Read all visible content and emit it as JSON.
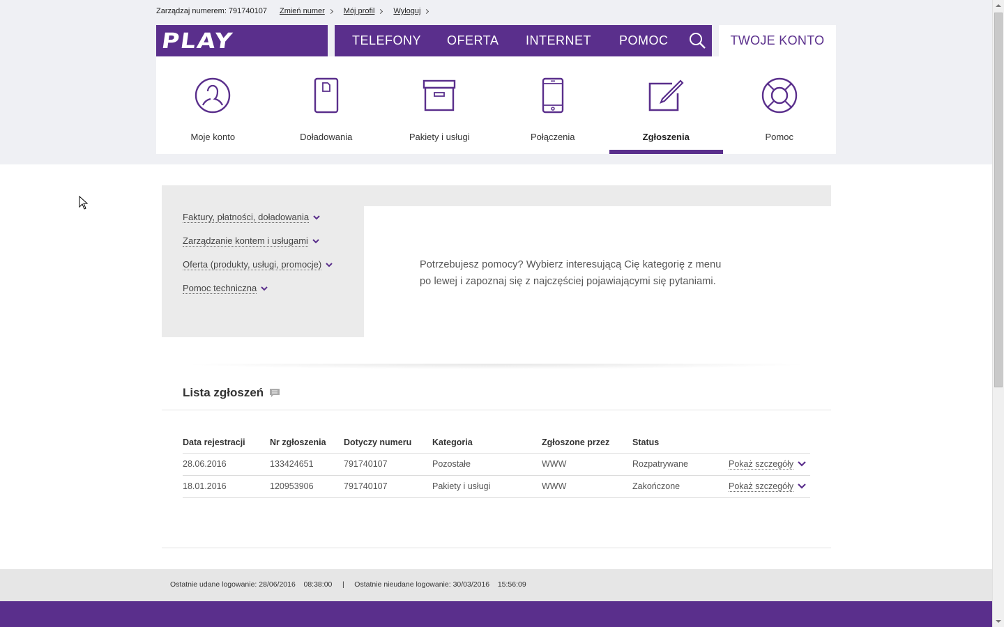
{
  "utility": {
    "account_text": "Zarządzaj numerem: 791740107",
    "links": [
      "Zmień numer",
      "Mój profil",
      "Wyloguj"
    ]
  },
  "logo": "PLAY",
  "nav": {
    "items": [
      "TELEFONY",
      "OFERTA",
      "INTERNET",
      "POMOC"
    ],
    "account_tab": "TWOJE KONTO"
  },
  "account_menu": [
    {
      "label": "Moje konto",
      "icon": "user-icon"
    },
    {
      "label": "Doładowania",
      "icon": "phone-card-icon"
    },
    {
      "label": "Pakiety i usługi",
      "icon": "package-box-icon"
    },
    {
      "label": "Połączenia",
      "icon": "smartphone-icon"
    },
    {
      "label": "Zgłoszenia",
      "icon": "edit-note-icon",
      "active": true
    },
    {
      "label": "Pomoc",
      "icon": "lifebuoy-icon"
    }
  ],
  "help": {
    "categories": [
      "Faktury, płatności, doładowania",
      "Zarządzanie kontem i usługami",
      "Oferta (produkty, usługi, promocje)",
      "Pomoc techniczna"
    ],
    "text_line1": "Potrzebujesz pomocy? Wybierz interesującą Cię kategorię z menu",
    "text_line2": "po lewej i zapoznaj się z najczęściej pojawiającymi się pytaniami."
  },
  "tickets": {
    "title": "Lista zgłoszeń",
    "columns": [
      "Data rejestracji",
      "Nr zgłoszenia",
      "Dotyczy numeru",
      "Kategoria",
      "Zgłoszone przez",
      "Status"
    ],
    "rows": [
      {
        "date": "28.06.2016",
        "number": "133424651",
        "phone": "791740107",
        "category": "Pozostałe",
        "by": "WWW",
        "status": "Rozpatrywane",
        "details": "Pokaż szczegóły"
      },
      {
        "date": "18.01.2016",
        "number": "120953906",
        "phone": "791740107",
        "category": "Pakiety i usługi",
        "by": "WWW",
        "status": "Zakończone",
        "details": "Pokaż szczegóły"
      }
    ]
  },
  "login_info": {
    "last_success_label": "Ostatnie udane logowanie:",
    "last_success_date": "28/06/2016",
    "last_success_time": "08:38:00",
    "separator": "|",
    "last_failed_label": "Ostatnie nieudane logowanie:",
    "last_failed_date": "30/03/2016",
    "last_failed_time": "15:56:09"
  },
  "colors": {
    "brand_purple": "#5a2f8c",
    "band_gray": "#eff0f4"
  }
}
